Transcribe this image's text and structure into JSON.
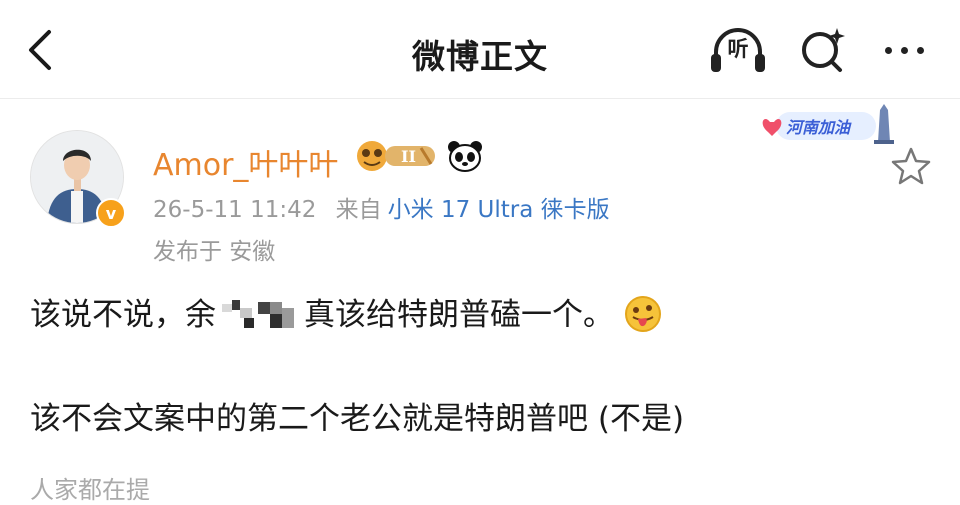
{
  "navbar": {
    "title": "微博正文",
    "listen_label": "听",
    "icons": {
      "back": "chevron-left-icon",
      "listen": "headphones-icon",
      "search": "search-sparkle-icon",
      "more": "more-dots-icon"
    }
  },
  "post": {
    "author": {
      "name": "Amor_叶叶叶",
      "verified": true
    },
    "timestamp": "26-5-11 11:42",
    "source_prefix": "来自",
    "source": "小米 17 Ultra 徕卡版",
    "location": "发布于 安徽",
    "sticker_text": "河南加油",
    "line1_part1": "该说不说，余",
    "line1_part2": "真该给特朗普磕一个。",
    "line2": "该不会文案中的第二个老公就是特朗普吧 (不是)",
    "line3_partial": "人家都在提"
  },
  "colors": {
    "username": "#e8862f",
    "source_link": "#3a77c4",
    "meta_gray": "#9a9a9a",
    "verified": "#f7a11b"
  }
}
